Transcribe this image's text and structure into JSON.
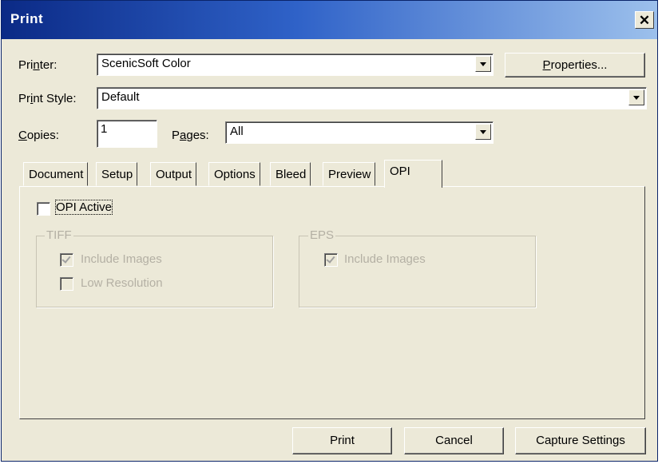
{
  "window": {
    "title": "Print"
  },
  "printer": {
    "label": "Printer:",
    "value": "ScenicSoft Color",
    "properties_button": "Properties..."
  },
  "print_style": {
    "label": "Print Style:",
    "value": "Default"
  },
  "copies": {
    "label": "Copies:",
    "value": "1"
  },
  "pages": {
    "label": "Pages:",
    "value": "All"
  },
  "tabs": [
    "Document",
    "Setup",
    "Output",
    "Options",
    "Bleed",
    "Preview",
    "OPI"
  ],
  "opi": {
    "opi_active_label": "OPI Active",
    "tiff": {
      "title": "TIFF",
      "include_images": "Include Images",
      "low_resolution": "Low Resolution"
    },
    "eps": {
      "title": "EPS",
      "include_images": "Include Images"
    }
  },
  "buttons": {
    "print": "Print",
    "cancel": "Cancel",
    "capture": "Capture Settings"
  }
}
